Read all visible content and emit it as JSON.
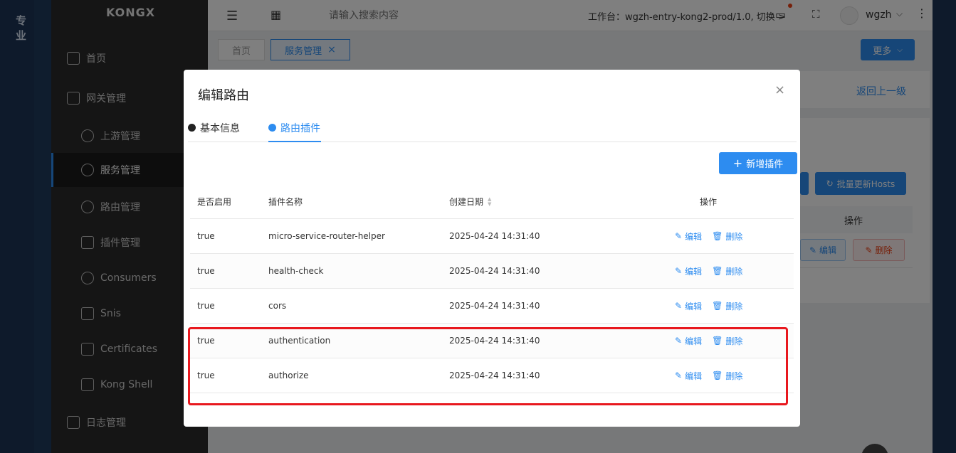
{
  "outer": {
    "brand": "专业"
  },
  "sidebar": {
    "logo": "KONGX",
    "items": [
      {
        "label": "首页"
      },
      {
        "label": "网关管理"
      },
      {
        "label": "上游管理"
      },
      {
        "label": "服务管理"
      },
      {
        "label": "路由管理"
      },
      {
        "label": "插件管理"
      },
      {
        "label": "Consumers"
      },
      {
        "label": "Snis"
      },
      {
        "label": "Certificates"
      },
      {
        "label": "Kong Shell"
      },
      {
        "label": "日志管理"
      }
    ]
  },
  "header": {
    "search_placeholder": "请输入搜索内容",
    "workspace": "工作台：wgzh-entry-kong2-prod/1.0, 切换 >",
    "user": "wgzh"
  },
  "tabs": [
    {
      "label": "首页"
    },
    {
      "label": "服务管理",
      "close": "×"
    }
  ],
  "more_label": "更多",
  "background_page": {
    "back_link": "返回上一级",
    "batch_button": "批量更新Hosts",
    "column_action": "操作",
    "edit_label": "编辑",
    "delete_label": "删除"
  },
  "modal": {
    "title": "编辑路由",
    "close": "×",
    "tabs": [
      {
        "label": "基本信息"
      },
      {
        "label": "路由插件"
      }
    ],
    "add_button": "新增插件",
    "columns": [
      "是否启用",
      "插件名称",
      "创建日期",
      "操作"
    ],
    "rows": [
      {
        "enabled": "true",
        "name": "micro-service-router-helper",
        "created": "2025-04-24 14:31:40"
      },
      {
        "enabled": "true",
        "name": "health-check",
        "created": "2025-04-24 14:31:40"
      },
      {
        "enabled": "true",
        "name": "cors",
        "created": "2025-04-24 14:31:40"
      },
      {
        "enabled": "true",
        "name": "authentication",
        "created": "2025-04-24 14:31:40"
      },
      {
        "enabled": "true",
        "name": "authorize",
        "created": "2025-04-24 14:31:40"
      }
    ],
    "edit_label": "编辑",
    "delete_label": "删除"
  },
  "colors": {
    "primary": "#2d8cf0",
    "highlight": "#e8181e",
    "danger": "#ed4014"
  }
}
